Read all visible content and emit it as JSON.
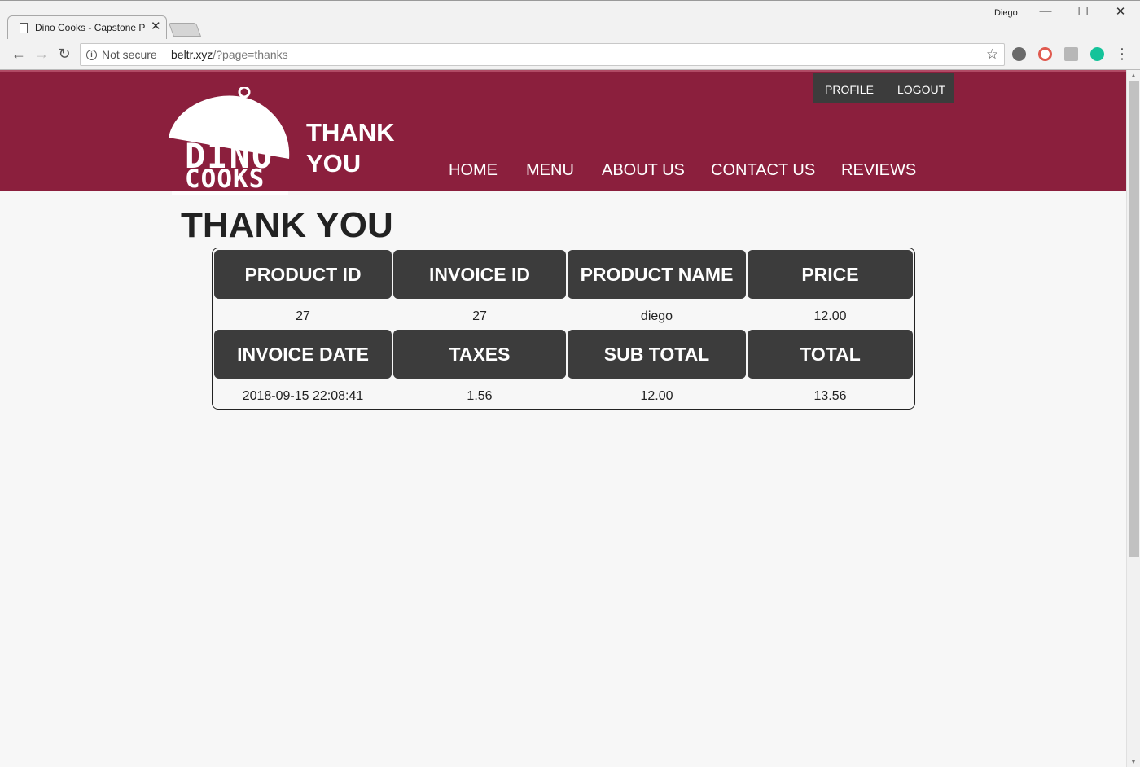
{
  "browser": {
    "tab_title": "Dino Cooks - Capstone P",
    "user": "Diego",
    "security_label": "Not secure",
    "url_host": "beltr.xyz",
    "url_rest": "/?page=thanks"
  },
  "logo": {
    "line1": "DINO",
    "line2": "COOKS"
  },
  "header": {
    "title": "THANK YOU",
    "account": [
      "PROFILE",
      "LOGOUT"
    ],
    "nav": [
      "HOME",
      "MENU",
      "ABOUT US",
      "CONTACT US",
      "REVIEWS"
    ]
  },
  "page": {
    "heading": "THANK YOU"
  },
  "invoice": {
    "header_row_1": [
      "PRODUCT ID",
      "INVOICE ID",
      "PRODUCT NAME",
      "PRICE"
    ],
    "value_row_1": [
      "27",
      "27",
      "diego",
      "12.00"
    ],
    "header_row_2": [
      "INVOICE DATE",
      "TAXES",
      "SUB TOTAL",
      "TOTAL"
    ],
    "value_row_2": [
      "2018-09-15 22:08:41",
      "1.56",
      "12.00",
      "13.56"
    ]
  },
  "colors": {
    "brand": "#8b1f3d",
    "cell_header": "#3c3c3c",
    "page_bg": "#f7f7f7"
  }
}
